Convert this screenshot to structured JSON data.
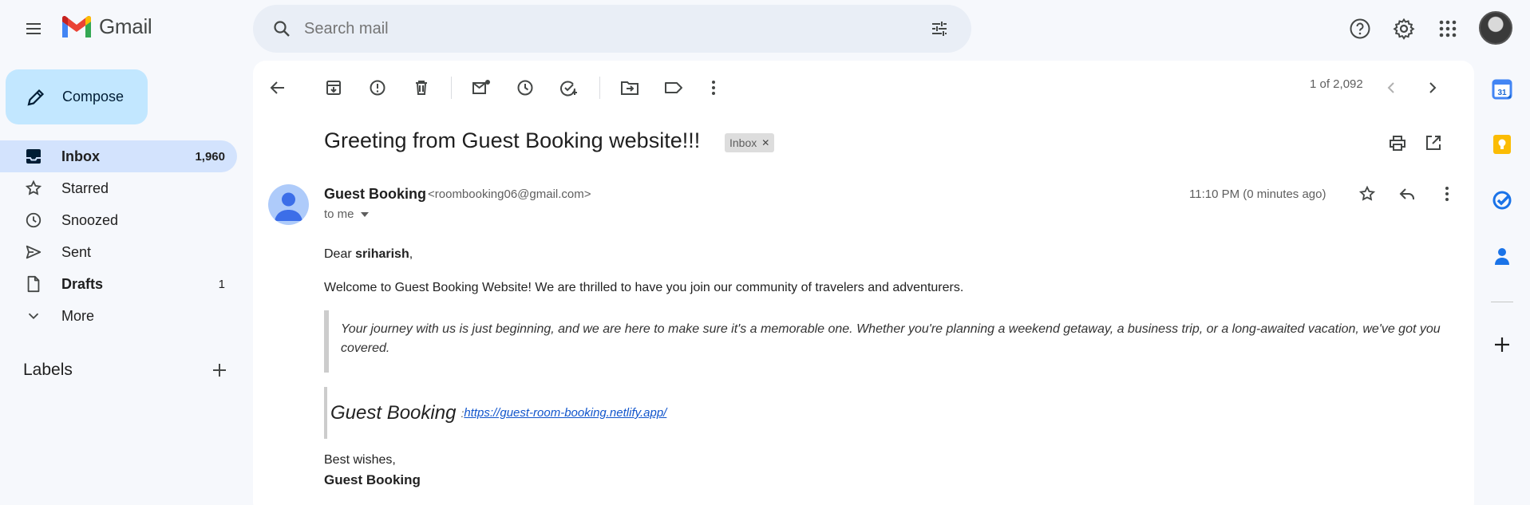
{
  "app": {
    "name": "Gmail"
  },
  "search": {
    "placeholder": "Search mail"
  },
  "compose": {
    "label": "Compose"
  },
  "nav": {
    "items": [
      {
        "label": "Inbox",
        "count": "1,960",
        "icon": "inbox-icon"
      },
      {
        "label": "Starred",
        "count": "",
        "icon": "star-icon"
      },
      {
        "label": "Snoozed",
        "count": "",
        "icon": "clock-icon"
      },
      {
        "label": "Sent",
        "count": "",
        "icon": "send-icon"
      },
      {
        "label": "Drafts",
        "count": "1",
        "icon": "draft-icon"
      },
      {
        "label": "More",
        "count": "",
        "icon": "chevron-down-icon"
      }
    ]
  },
  "labels": {
    "heading": "Labels"
  },
  "toolbar": {
    "pager": "1 of 2,092"
  },
  "email": {
    "subject": "Greeting from Guest Booking website!!!",
    "chip": "Inbox",
    "sender_name": "Guest Booking",
    "sender_email": "<roombooking06@gmail.com>",
    "to": "to me",
    "time": "11:10 PM (0 minutes ago)",
    "greeting_prefix": "Dear ",
    "greeting_name": "sriharish",
    "greeting_suffix": ",",
    "intro": "Welcome to  Guest Booking Website! We are thrilled to have you join our community of travelers and adventurers.",
    "quote": "Your journey with us is just beginning, and we are here to make sure it's a memorable one. Whether you're planning a weekend getaway, a business trip, or a long-awaited vacation, we've got you covered.",
    "brand": "Guest Booking",
    "brand_colon": ":",
    "link": "https://guest-room-booking.netlify.app/",
    "closing": "Best wishes,",
    "signature": "Guest Booking"
  },
  "rail": {
    "calendar_day": "31"
  },
  "colors": {
    "accent": "#0b57d0",
    "compose_bg": "#c2e7ff",
    "active_nav": "#d3e3fd",
    "page_bg": "#f6f8fc"
  }
}
